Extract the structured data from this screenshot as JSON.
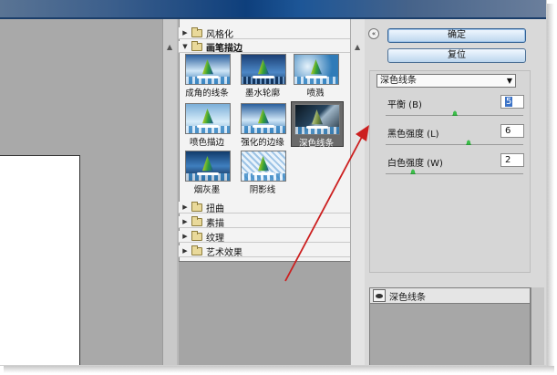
{
  "filter_categories": [
    {
      "label": "风格化",
      "open": false
    },
    {
      "label": "画笔描边",
      "open": true
    },
    {
      "label": "扭曲",
      "open": false
    },
    {
      "label": "素描",
      "open": false
    },
    {
      "label": "纹理",
      "open": false
    },
    {
      "label": "艺术效果",
      "open": false
    }
  ],
  "thumbnails": [
    {
      "label": "成角的线条",
      "style": "edge",
      "selected": false
    },
    {
      "label": "墨水轮廓",
      "style": "ink",
      "selected": false
    },
    {
      "label": "喷溅",
      "style": "spray",
      "selected": false
    },
    {
      "label": "喷色描边",
      "style": "pale",
      "selected": false
    },
    {
      "label": "强化的边缘",
      "style": "edge",
      "selected": false
    },
    {
      "label": "深色线条",
      "style": "dark",
      "selected": true
    },
    {
      "label": "烟灰墨",
      "style": "smudge",
      "selected": false
    },
    {
      "label": "阴影线",
      "style": "hatch",
      "selected": false
    }
  ],
  "buttons": {
    "ok": "确定",
    "reset": "复位"
  },
  "filter_select": {
    "value": "深色线条"
  },
  "params": [
    {
      "label": "平衡 (B)",
      "value": "5",
      "fraction": 0.5,
      "focused": true
    },
    {
      "label": "黑色强度 (L)",
      "value": "6",
      "fraction": 0.6,
      "focused": false
    },
    {
      "label": "白色强度 (W)",
      "value": "2",
      "fraction": 0.2,
      "focused": false
    }
  ],
  "layer": {
    "label": "深色线条"
  },
  "colors": {
    "annotation_arrow": "#cc1f1f",
    "accent": "#3c73c7"
  }
}
